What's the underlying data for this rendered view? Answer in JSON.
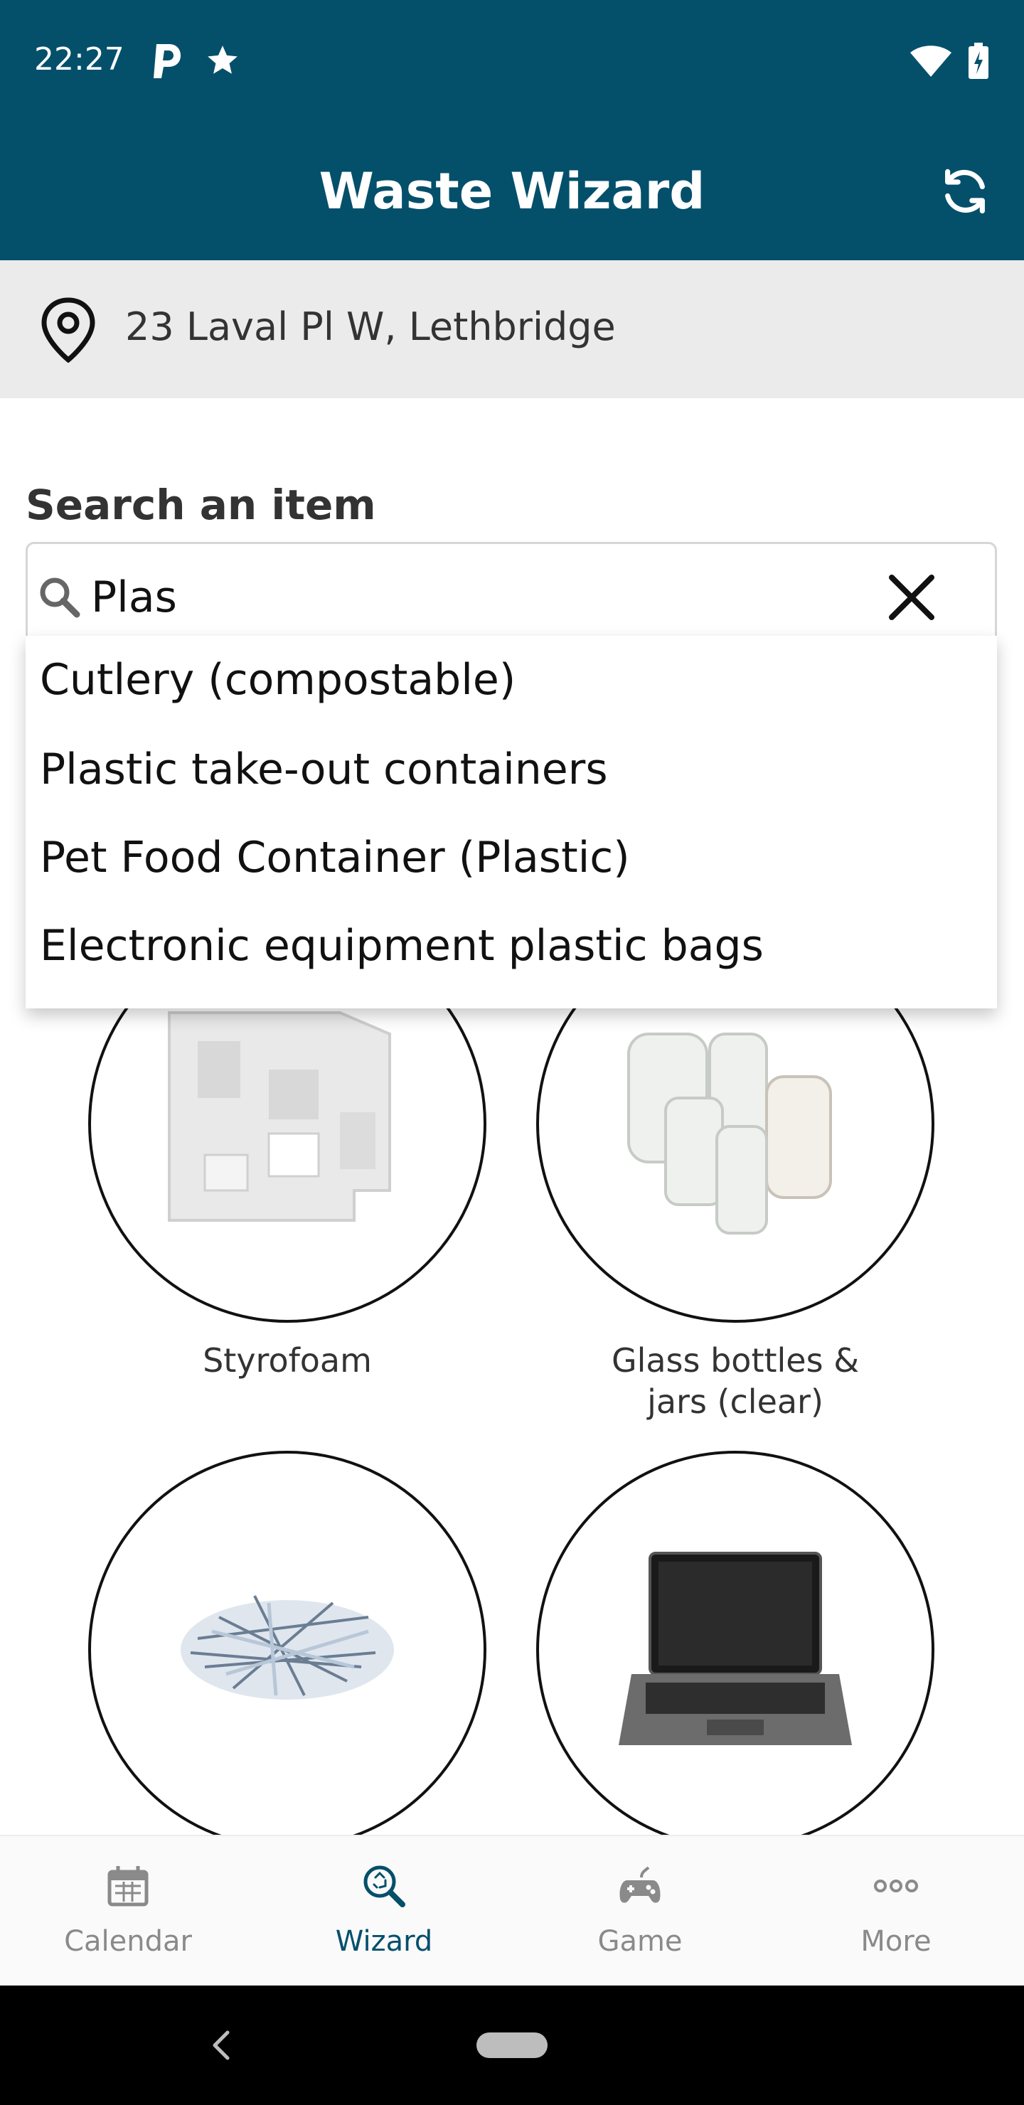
{
  "status_bar": {
    "time": "22:27"
  },
  "app_bar": {
    "title": "Waste Wizard"
  },
  "location": {
    "address": "23 Laval Pl W, Lethbridge"
  },
  "search": {
    "label": "Search an item",
    "value": "Plas",
    "suggestions": [
      "Cutlery (compostable)",
      "Plastic take-out containers",
      "Pet Food Container (Plastic)",
      "Electronic equipment plastic bags"
    ]
  },
  "items": [
    {
      "caption": "Styrofoam",
      "icon": "styrofoam-image"
    },
    {
      "caption": "Glass bottles &",
      "caption_line2": "jars (clear)",
      "icon": "glass-jars-image"
    },
    {
      "caption": "",
      "icon": "shredded-paper-image"
    },
    {
      "caption": "",
      "icon": "laptop-image"
    }
  ],
  "bottom_nav": {
    "items": [
      {
        "label": "Calendar",
        "icon": "calendar-icon",
        "active": false
      },
      {
        "label": "Wizard",
        "icon": "wizard-search-icon",
        "active": true
      },
      {
        "label": "Game",
        "icon": "gamepad-icon",
        "active": false
      },
      {
        "label": "More",
        "icon": "more-icon",
        "active": false
      }
    ]
  },
  "colors": {
    "primary": "#04506b",
    "location_bar": "#ebebeb",
    "nav_inactive": "#8a8a8a"
  }
}
